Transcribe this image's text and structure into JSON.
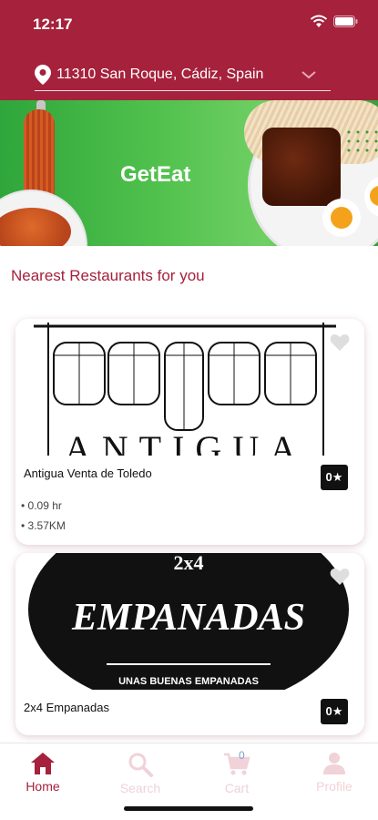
{
  "status_bar": {
    "time": "12:17"
  },
  "location": {
    "address": "11310 San Roque, Cádiz, Spain"
  },
  "banner": {
    "title": "GetEat"
  },
  "section": {
    "title": "Nearest Restaurants for you"
  },
  "restaurants": [
    {
      "name": "Antigua Venta de Toledo",
      "rating": "0★",
      "time": "• 0.09 hr",
      "distance": "• 3.57KM",
      "logo_text": "ANTIGUA"
    },
    {
      "name": "2x4 Empanadas",
      "rating": "0★",
      "logo_top": "2x4",
      "logo_main": "EMPANADAS",
      "logo_sub": "UNAS BUENAS EMPANADAS"
    }
  ],
  "tabs": [
    {
      "label": "Home",
      "icon": "home-icon",
      "active": true
    },
    {
      "label": "Search",
      "icon": "search-icon",
      "active": false
    },
    {
      "label": "Cart",
      "icon": "cart-icon",
      "active": false,
      "badge": "0"
    },
    {
      "label": "Profile",
      "icon": "profile-icon",
      "active": false
    }
  ],
  "colors": {
    "brand": "#a5213c",
    "banner_green": "#4fc04c",
    "tab_inactive": "#f0d2d8"
  }
}
